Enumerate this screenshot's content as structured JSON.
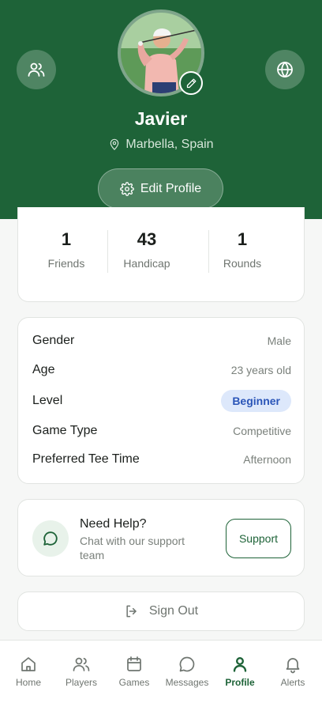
{
  "profile": {
    "name": "Javier",
    "location": "Marbella, Spain",
    "edit_label": "Edit Profile"
  },
  "stats": [
    {
      "value": "1",
      "label": "Friends"
    },
    {
      "value": "43",
      "label": "Handicap"
    },
    {
      "value": "1",
      "label": "Rounds"
    }
  ],
  "details": {
    "gender": {
      "label": "Gender",
      "value": "Male"
    },
    "age": {
      "label": "Age",
      "value": "23 years old"
    },
    "level": {
      "label": "Level",
      "value": "Beginner"
    },
    "game_type": {
      "label": "Game Type",
      "value": "Competitive"
    },
    "tee_time": {
      "label": "Preferred Tee Time",
      "value": "Afternoon"
    }
  },
  "help": {
    "title": "Need Help?",
    "subtitle": "Chat with our support team",
    "button_label": "Support"
  },
  "signout_label": "Sign Out",
  "tabs": [
    {
      "label": "Home",
      "icon": "home-icon"
    },
    {
      "label": "Players",
      "icon": "users-icon"
    },
    {
      "label": "Games",
      "icon": "calendar-icon"
    },
    {
      "label": "Messages",
      "icon": "chat-icon"
    },
    {
      "label": "Profile",
      "icon": "user-icon",
      "active": true
    },
    {
      "label": "Alerts",
      "icon": "bell-icon"
    }
  ],
  "colors": {
    "brand_green": "#1e6338",
    "level_badge_bg": "#dde8fb",
    "level_badge_text": "#2a55b8"
  }
}
